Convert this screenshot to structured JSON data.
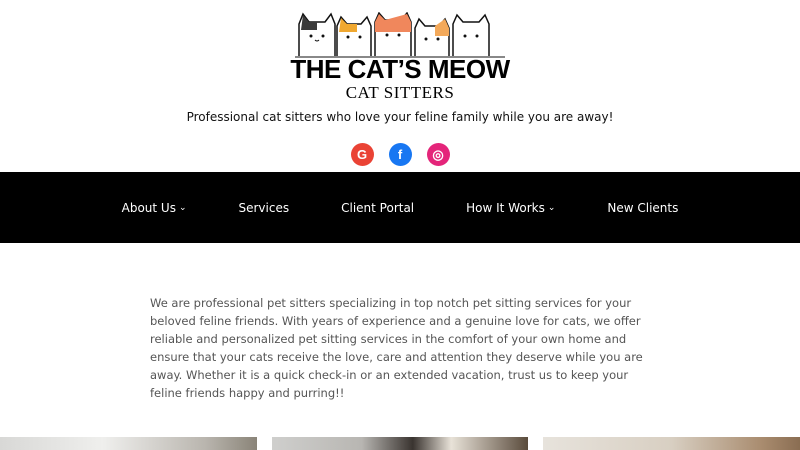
{
  "brand": {
    "title": "THE CAT’S MEOW",
    "subtitle": "CAT SITTERS"
  },
  "tagline": "Professional cat sitters who love your feline family while you are away!",
  "social": [
    {
      "icon": "google-icon",
      "glyph": "G",
      "color": "#ea4335"
    },
    {
      "icon": "facebook-icon",
      "glyph": "f",
      "color": "#1877f2"
    },
    {
      "icon": "instagram-icon",
      "glyph": "◎",
      "color": "#e4257a"
    }
  ],
  "nav": {
    "items": [
      {
        "label": "About Us",
        "dropdown": true
      },
      {
        "label": "Services",
        "dropdown": false
      },
      {
        "label": "Client Portal",
        "dropdown": false
      },
      {
        "label": "How It Works",
        "dropdown": true
      },
      {
        "label": "New Clients",
        "dropdown": false
      }
    ],
    "chevron": "⌄"
  },
  "intro": "We are professional pet sitters specializing in top notch pet sitting services for your beloved feline friends. With years of experience and a genuine love for cats, we offer reliable and personalized pet sitting services in the comfort of your own home and ensure that your cats receive the love, care and attention they deserve while you are away. Whether it is a quick check-in or an extended vacation, trust us to keep your feline friends happy and purring!!"
}
